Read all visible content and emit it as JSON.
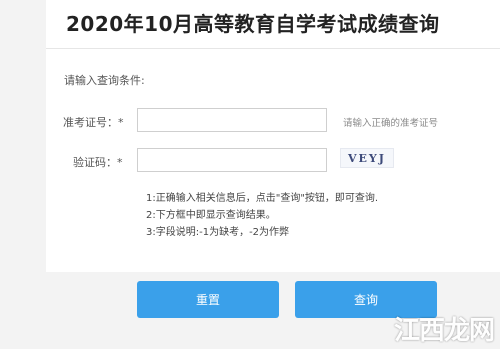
{
  "title": "2020年10月高等教育自学考试成绩查询",
  "form": {
    "prompt": "请输入查询条件:",
    "exam_id_label": "准考证号：*",
    "exam_id_value": "",
    "exam_id_hint": "请输入正确的准考证号",
    "captcha_label": "验证码：*",
    "captcha_value": "",
    "captcha_text": "VEYJ"
  },
  "notes": [
    "1:正确输入相关信息后，点击\"查询\"按钮，即可查询.",
    "2:下方框中即显示查询结果。",
    "3:字段说明:-1为缺考，-2为作弊"
  ],
  "buttons": {
    "reset_label": "重置",
    "query_label": "查询"
  },
  "watermark": {
    "text": "江西龙网"
  },
  "colors": {
    "button": "#3aa0ea",
    "page_background": "#f3f3f3"
  }
}
